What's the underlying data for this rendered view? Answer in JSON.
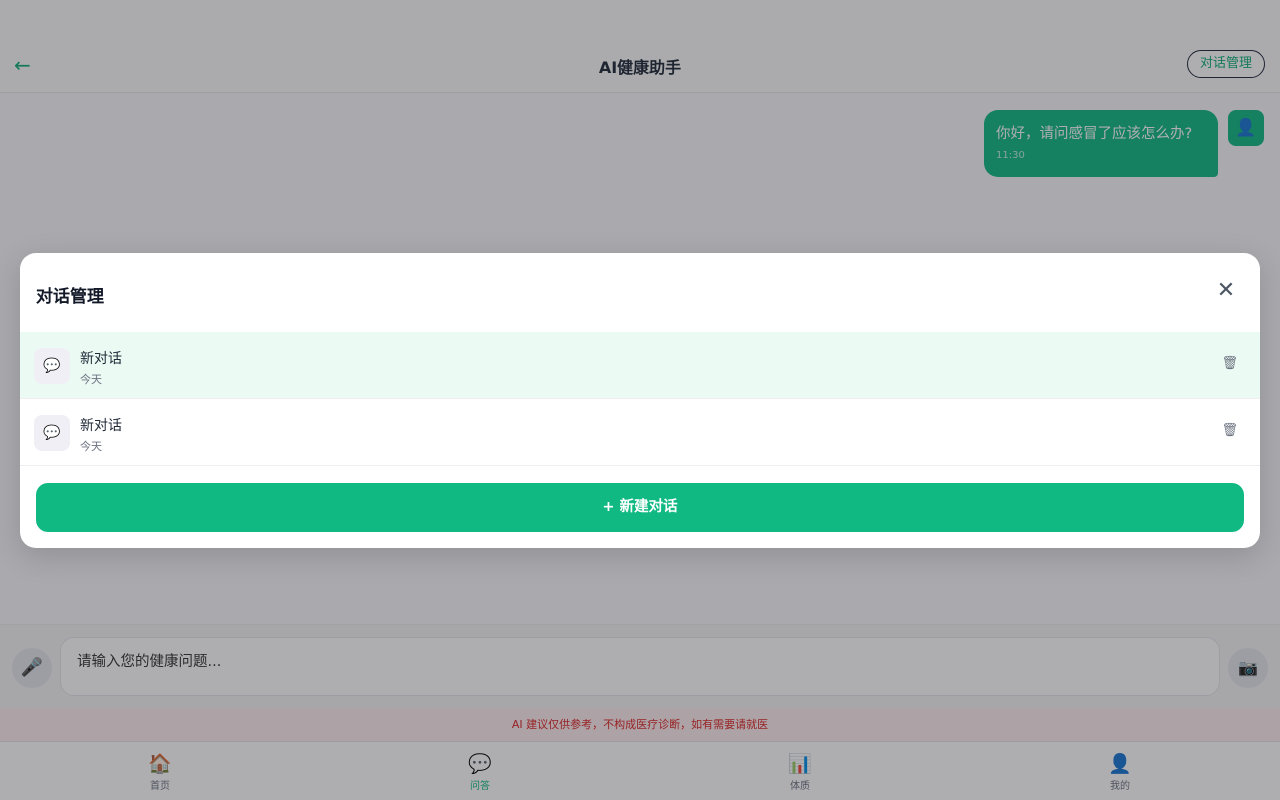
{
  "header": {
    "back_icon": "←",
    "title": "AI健康助手",
    "manage_label": "对话管理"
  },
  "chat": {
    "messages": [
      {
        "text": "你好，请问感冒了应该怎么办?",
        "time": "11:30",
        "avatar_icon": "👤"
      }
    ]
  },
  "input": {
    "mic_icon": "🎤",
    "placeholder": "请输入您的健康问题...",
    "camera_icon": "📷"
  },
  "disclaimer": "AI 建议仅供参考，不构成医疗诊断，如有需要请就医",
  "tabbar": {
    "items": [
      {
        "icon": "🏠",
        "label": "首页",
        "active": false
      },
      {
        "icon": "💬",
        "label": "问答",
        "active": true
      },
      {
        "icon": "📊",
        "label": "体质",
        "active": false
      },
      {
        "icon": "👤",
        "label": "我的",
        "active": false
      }
    ]
  },
  "modal": {
    "title": "对话管理",
    "close_icon": "✕",
    "conversations": [
      {
        "icon": "💬",
        "name": "新对话",
        "date": "今天",
        "delete_icon": "🗑",
        "active": true
      },
      {
        "icon": "💬",
        "name": "新对话",
        "date": "今天",
        "delete_icon": "🗑",
        "active": false
      }
    ],
    "new_button_label": "+ 新建对话"
  },
  "colors": {
    "accent": "#10b981",
    "active_row": "#ebfaf3",
    "disclaimer_text": "#dc2626",
    "disclaimer_bg": "#fdecec"
  }
}
